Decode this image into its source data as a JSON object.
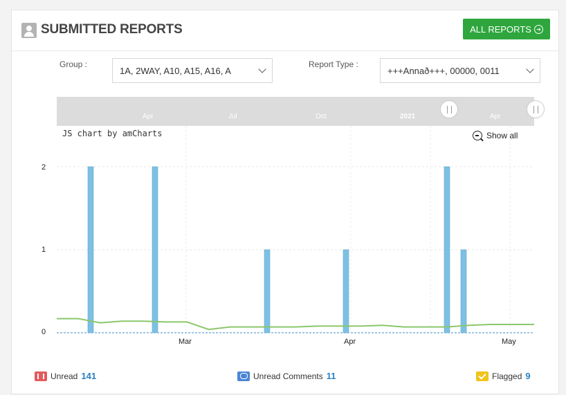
{
  "header": {
    "title": "SUBMITTED REPORTS",
    "all_reports_label": "ALL REPORTS"
  },
  "filters": {
    "group_label": "Group :",
    "group_value": "1A, 2WAY, A10, A15, A16, A",
    "report_type_label": "Report Type :",
    "report_type_value": "+++Annað+++, 00000, 0011"
  },
  "scrollbar": {
    "months": [
      "Apr",
      "Jul",
      "Oct",
      "2021",
      "Apr"
    ]
  },
  "chart": {
    "credit": "JS chart by amCharts",
    "show_all_label": "Show all"
  },
  "chart_data": {
    "type": "bar",
    "bar_color": "#7dc0e3",
    "line_color": "#8bc76a",
    "ylim": [
      0,
      2
    ],
    "yticks": [
      "0",
      "1",
      "2"
    ],
    "xticks": [
      "Mar",
      "Apr",
      "May"
    ],
    "categories": [
      "Feb 12",
      "Feb 24",
      "Mar 17",
      "Apr 1",
      "Apr 19",
      "Apr 22"
    ],
    "values": [
      2,
      2,
      1,
      1,
      2,
      1
    ],
    "trend_line": [
      0.17,
      0.17,
      0.12,
      0.14,
      0.14,
      0.13,
      0.13,
      0.04,
      0.07,
      0.07,
      0.07,
      0.07,
      0.08,
      0.08,
      0.08,
      0.09,
      0.07,
      0.07,
      0.07,
      0.09,
      0.1,
      0.1,
      0.1
    ]
  },
  "footer": {
    "unread_label": "Unread",
    "unread_count": "141",
    "comments_label": "Unread Comments",
    "comments_count": "11",
    "flagged_label": "Flagged",
    "flagged_count": "9"
  }
}
